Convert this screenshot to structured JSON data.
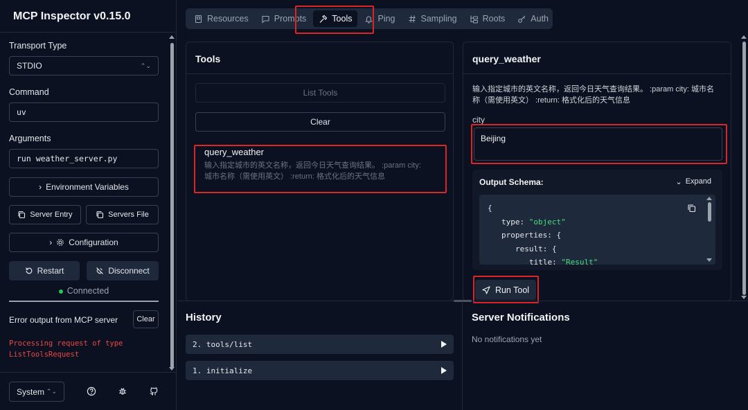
{
  "app": {
    "title": "MCP Inspector v0.15.0"
  },
  "sidebar": {
    "transport_label": "Transport Type",
    "transport_value": "STDIO",
    "command_label": "Command",
    "command_value": "uv",
    "arguments_label": "Arguments",
    "arguments_value": "run weather_server.py",
    "env_vars_label": "Environment Variables",
    "server_entry_label": "Server Entry",
    "servers_file_label": "Servers File",
    "configuration_label": "Configuration",
    "restart_label": "Restart",
    "disconnect_label": "Disconnect",
    "status_text": "Connected",
    "status_color": "#22c55e",
    "error_title": "Error output from MCP server",
    "clear_label": "Clear",
    "error_lines": [
      "Processing request of type",
      "ListToolsRequest"
    ],
    "error_color": "#ef4444",
    "theme_value": "System"
  },
  "tabs": [
    {
      "label": "Resources",
      "icon": "file-icon"
    },
    {
      "label": "Prompts",
      "icon": "message-icon"
    },
    {
      "label": "Tools",
      "icon": "hammer-icon",
      "active": true
    },
    {
      "label": "Ping",
      "icon": "bell-icon"
    },
    {
      "label": "Sampling",
      "icon": "hash-icon"
    },
    {
      "label": "Roots",
      "icon": "folder-tree-icon"
    },
    {
      "label": "Auth",
      "icon": "key-icon"
    }
  ],
  "tools_panel": {
    "title": "Tools",
    "list_tools_label": "List Tools",
    "clear_label": "Clear",
    "tool_name": "query_weather",
    "tool_desc_line1": "输入指定城市的英文名称，返回今日天气查询结果。 :param city:",
    "tool_desc_line2": "城市名称（需使用英文） :return: 格式化后的天气信息"
  },
  "detail_panel": {
    "title": "query_weather",
    "desc_line1": "输入指定城市的英文名称，返回今日天气查询结果。 :param city: 城市名",
    "desc_line2": "称（需使用英文） :return: 格式化后的天气信息",
    "city_label": "city",
    "city_value": "Beijing",
    "schema_title": "Output Schema:",
    "expand_label": "Expand",
    "code": {
      "l1": "{",
      "l2_key": "type:",
      "l2_val": "\"object\"",
      "l3_key": "properties:",
      "l3_brace": "{",
      "l4_key": "result:",
      "l4_brace": "{",
      "l5_key": "title:",
      "l5_val": "\"Result\""
    },
    "run_label": "Run Tool"
  },
  "history": {
    "title": "History",
    "items": [
      "2. tools/list",
      "1. initialize"
    ]
  },
  "notifications": {
    "title": "Server Notifications",
    "empty_text": "No notifications yet"
  },
  "colors": {
    "highlight": "#dc2626",
    "accent_bg": "#1e293b"
  }
}
